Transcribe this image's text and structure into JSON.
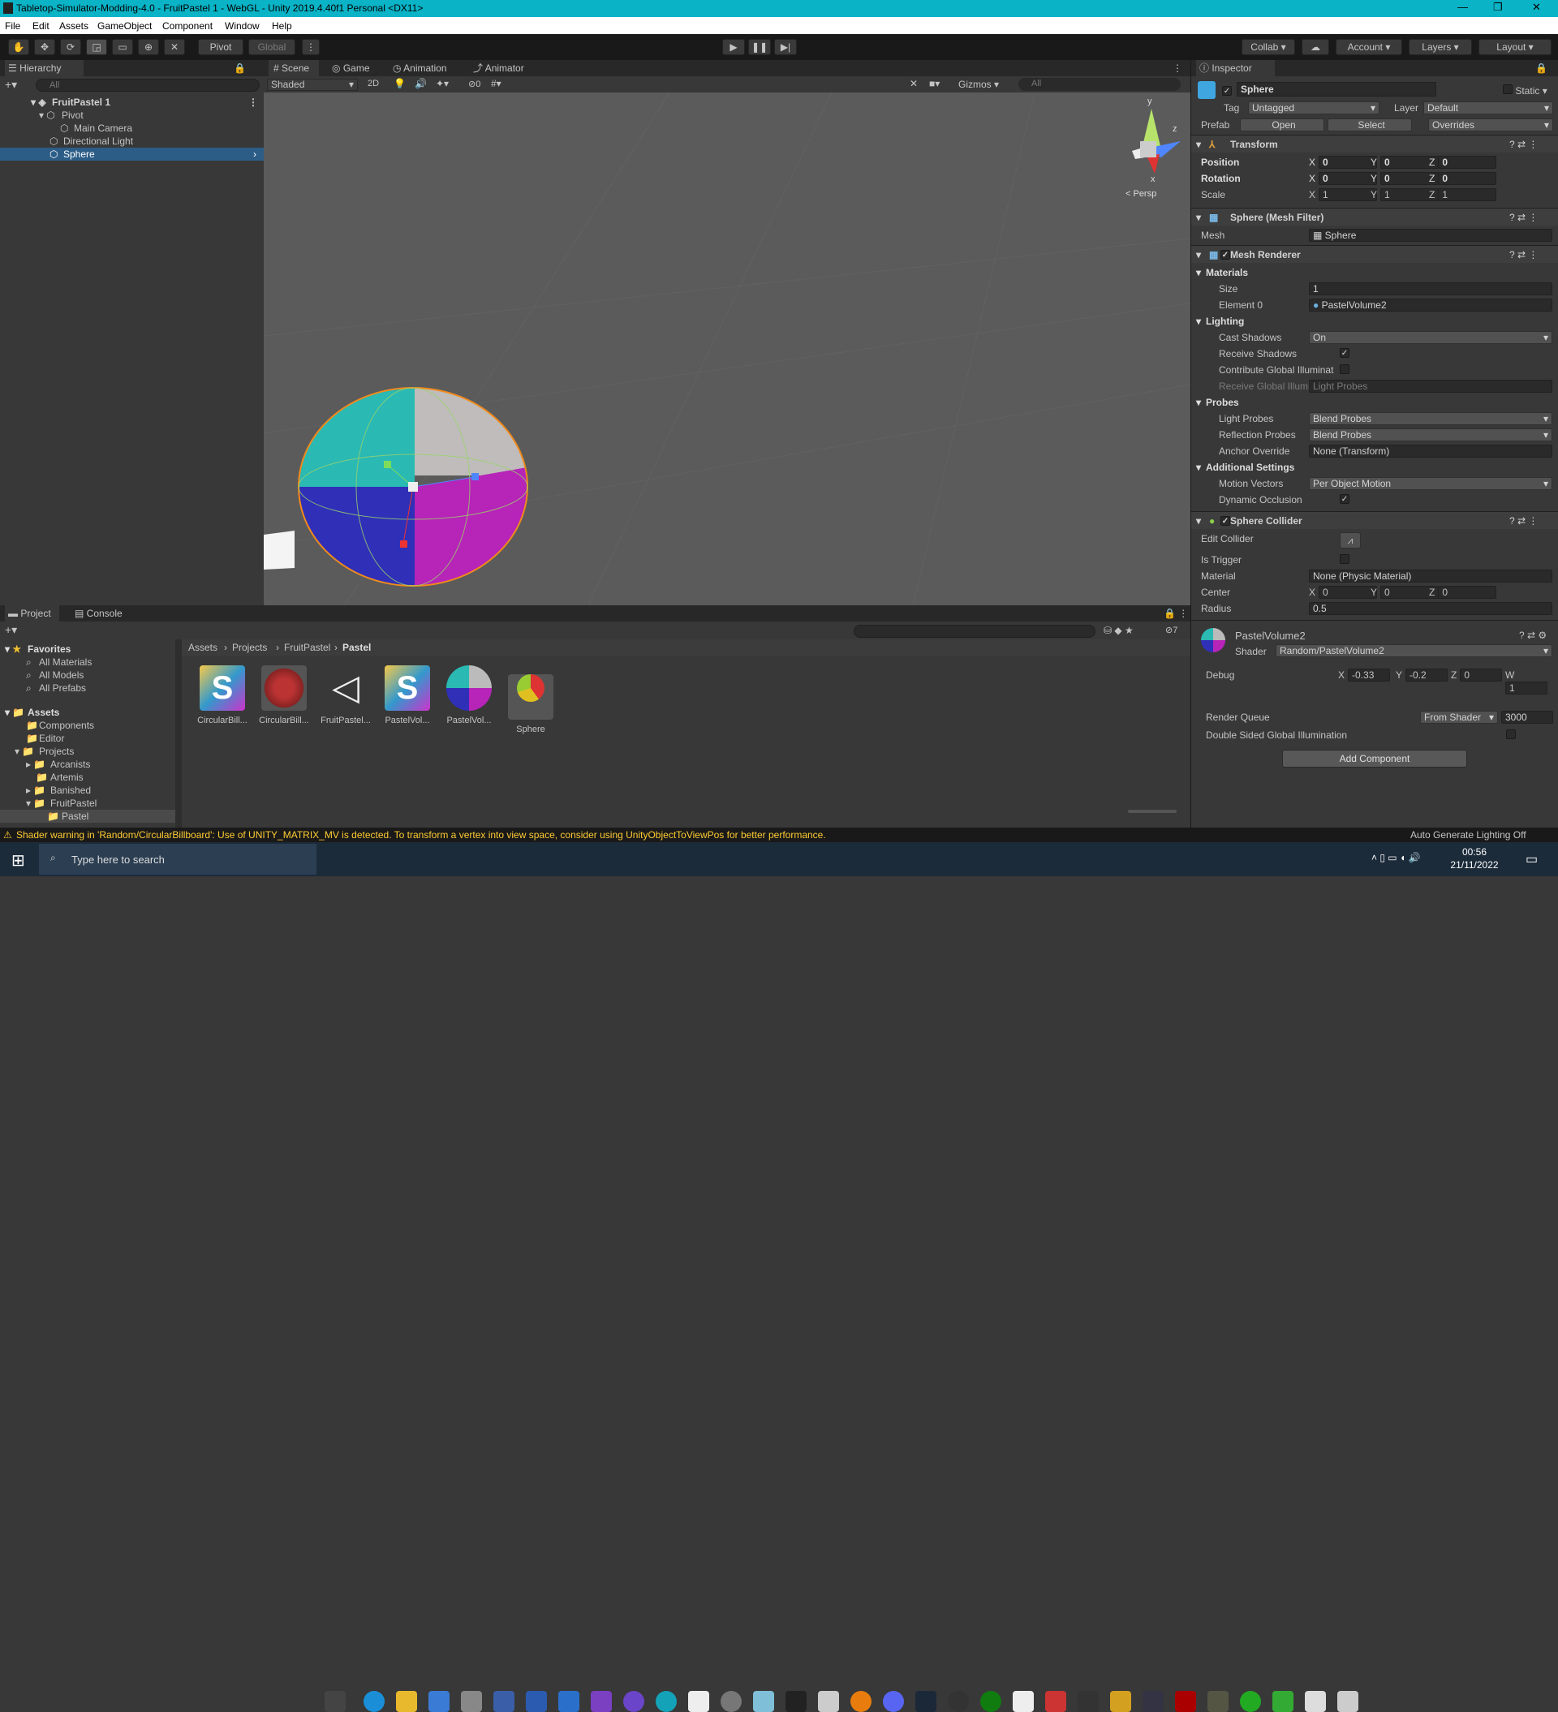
{
  "window": {
    "title": "Tabletop-Simulator-Modding-4.0 - FruitPastel 1 - WebGL - Unity 2019.4.40f1 Personal <DX11>"
  },
  "menu": [
    "File",
    "Edit",
    "Assets",
    "GameObject",
    "Component",
    "Window",
    "Help"
  ],
  "toolbar": {
    "pivot": "Pivot",
    "global": "Global",
    "collab": "Collab",
    "account": "Account",
    "layers": "Layers",
    "layout": "Layout"
  },
  "hierarchy": {
    "title": "Hierarchy",
    "search_placeholder": "All",
    "items": [
      "FruitPastel 1",
      "Pivot",
      "Main Camera",
      "Directional Light",
      "Sphere"
    ]
  },
  "scene": {
    "tabs": [
      "Scene",
      "Game",
      "Animation",
      "Animator"
    ],
    "shading": "Shaded",
    "mode2d": "2D",
    "hidden_count": "0",
    "gizmos": "Gizmos",
    "search_placeholder": "All",
    "persp": "< Persp",
    "axis_y": "y",
    "axis_x": "x",
    "axis_z": "z"
  },
  "inspector": {
    "title": "Inspector",
    "object": "Sphere",
    "static": "Static",
    "tag_label": "Tag",
    "tag": "Untagged",
    "layer_label": "Layer",
    "layer": "Default",
    "prefab_label": "Prefab",
    "open": "Open",
    "select": "Select",
    "overrides": "Overrides",
    "transform": {
      "title": "Transform",
      "position": "Position",
      "rotation": "Rotation",
      "scale": "Scale",
      "pos": [
        "0",
        "0",
        "0"
      ],
      "rot": [
        "0",
        "0",
        "0"
      ],
      "scl": [
        "1",
        "1",
        "1"
      ]
    },
    "meshfilter": {
      "title": "Sphere (Mesh Filter)",
      "mesh_label": "Mesh",
      "mesh": "Sphere"
    },
    "meshrenderer": {
      "title": "Mesh Renderer",
      "materials": "Materials",
      "size_label": "Size",
      "size": "1",
      "element_label": "Element 0",
      "element": "PastelVolume2",
      "lighting": "Lighting",
      "cast_label": "Cast Shadows",
      "cast": "On",
      "receive_label": "Receive Shadows",
      "contrib_label": "Contribute Global Illuminat",
      "recvgi_label": "Receive Global Illuminatior",
      "recvgi": "Light Probes",
      "probes": "Probes",
      "lp_label": "Light Probes",
      "lp": "Blend Probes",
      "rp_label": "Reflection Probes",
      "rp": "Blend Probes",
      "anchor_label": "Anchor Override",
      "anchor": "None (Transform)",
      "additional": "Additional Settings",
      "mv_label": "Motion Vectors",
      "mv": "Per Object Motion",
      "dyn_label": "Dynamic Occlusion"
    },
    "collider": {
      "title": "Sphere Collider",
      "edit_label": "Edit Collider",
      "trigger_label": "Is Trigger",
      "material_label": "Material",
      "material": "None (Physic Material)",
      "center_label": "Center",
      "center": [
        "0",
        "0",
        "0"
      ],
      "radius_label": "Radius",
      "radius": "0.5"
    },
    "material": {
      "name": "PastelVolume2",
      "shader_label": "Shader",
      "shader": "Random/PastelVolume2",
      "debug_label": "Debug",
      "debug": [
        "-0.33",
        "-0.2",
        "0",
        "1"
      ],
      "rq_label": "Render Queue",
      "rq_mode": "From Shader",
      "rq": "3000",
      "dsgi_label": "Double Sided Global Illumination"
    },
    "add_component": "Add Component"
  },
  "project": {
    "tabs": [
      "Project",
      "Console"
    ],
    "hidden_count": "7",
    "favorites": [
      "Favorites",
      "All Materials",
      "All Models",
      "All Prefabs"
    ],
    "tree": [
      "Assets",
      "Components",
      "Editor",
      "Projects",
      "Arcanists",
      "Artemis",
      "Banished",
      "FruitPastel",
      "Pastel"
    ],
    "breadcrumb": [
      "Assets",
      "Projects",
      "FruitPastel",
      "Pastel"
    ],
    "assets": [
      "CircularBill...",
      "CircularBill...",
      "FruitPastel...",
      "PastelVol...",
      "PastelVol...",
      "Sphere"
    ]
  },
  "status": {
    "warning": "Shader warning in 'Random/CircularBillboard': Use of UNITY_MATRIX_MV is detected. To transform a vertex into view space, consider using UnityObjectToViewPos for better performance.",
    "right": "Auto Generate Lighting Off"
  },
  "taskbar": {
    "search_placeholder": "Type here to search",
    "time": "00:56",
    "date": "21/11/2022"
  }
}
